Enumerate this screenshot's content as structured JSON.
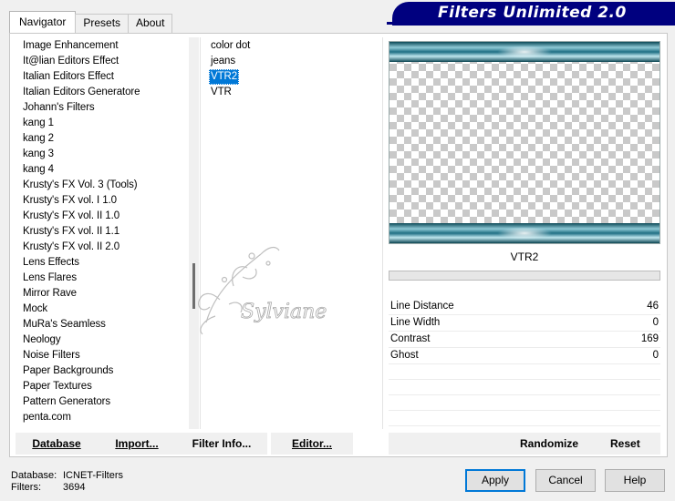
{
  "window": {
    "title": "Filters Unlimited 2.0"
  },
  "tabs": [
    {
      "label": "Navigator",
      "active": true
    },
    {
      "label": "Presets",
      "active": false
    },
    {
      "label": "About",
      "active": false
    }
  ],
  "categories": [
    "Image Enhancement",
    "It@lian Editors Effect",
    "Italian Editors Effect",
    "Italian Editors Generatore",
    "Johann's Filters",
    "kang 1",
    "kang 2",
    "kang 3",
    "kang 4",
    "Krusty's FX Vol. 3 (Tools)",
    "Krusty's FX vol. I 1.0",
    "Krusty's FX vol. II 1.0",
    "Krusty's FX vol. II 1.1",
    "Krusty's FX vol. II 2.0",
    "Lens Effects",
    "Lens Flares",
    "Mirror Rave",
    "Mock",
    "MuRa's Seamless",
    "Neology",
    "Noise Filters",
    "Paper Backgrounds",
    "Paper Textures",
    "Pattern Generators",
    "penta.com"
  ],
  "filters": [
    {
      "label": "color dot",
      "selected": false
    },
    {
      "label": "jeans",
      "selected": false
    },
    {
      "label": "VTR2",
      "selected": true
    },
    {
      "label": "VTR",
      "selected": false
    }
  ],
  "preview": {
    "filter_name": "VTR2"
  },
  "watermark": {
    "text": "Sylviane"
  },
  "parameters": [
    {
      "label": "Line Distance",
      "value": "46"
    },
    {
      "label": "Line Width",
      "value": "0"
    },
    {
      "label": "Contrast",
      "value": "169"
    },
    {
      "label": "Ghost",
      "value": "0"
    }
  ],
  "toolbar": {
    "database": "Database",
    "import": "Import...",
    "filter_info": "Filter Info...",
    "editor": "Editor...",
    "randomize": "Randomize",
    "reset": "Reset"
  },
  "footer": {
    "database_label": "Database:",
    "database_value": "ICNET-Filters",
    "filters_label": "Filters:",
    "filters_value": "3694",
    "apply": "Apply",
    "cancel": "Cancel",
    "help": "Help"
  },
  "colors": {
    "banner": "#00007f",
    "selection": "#0078d7"
  }
}
